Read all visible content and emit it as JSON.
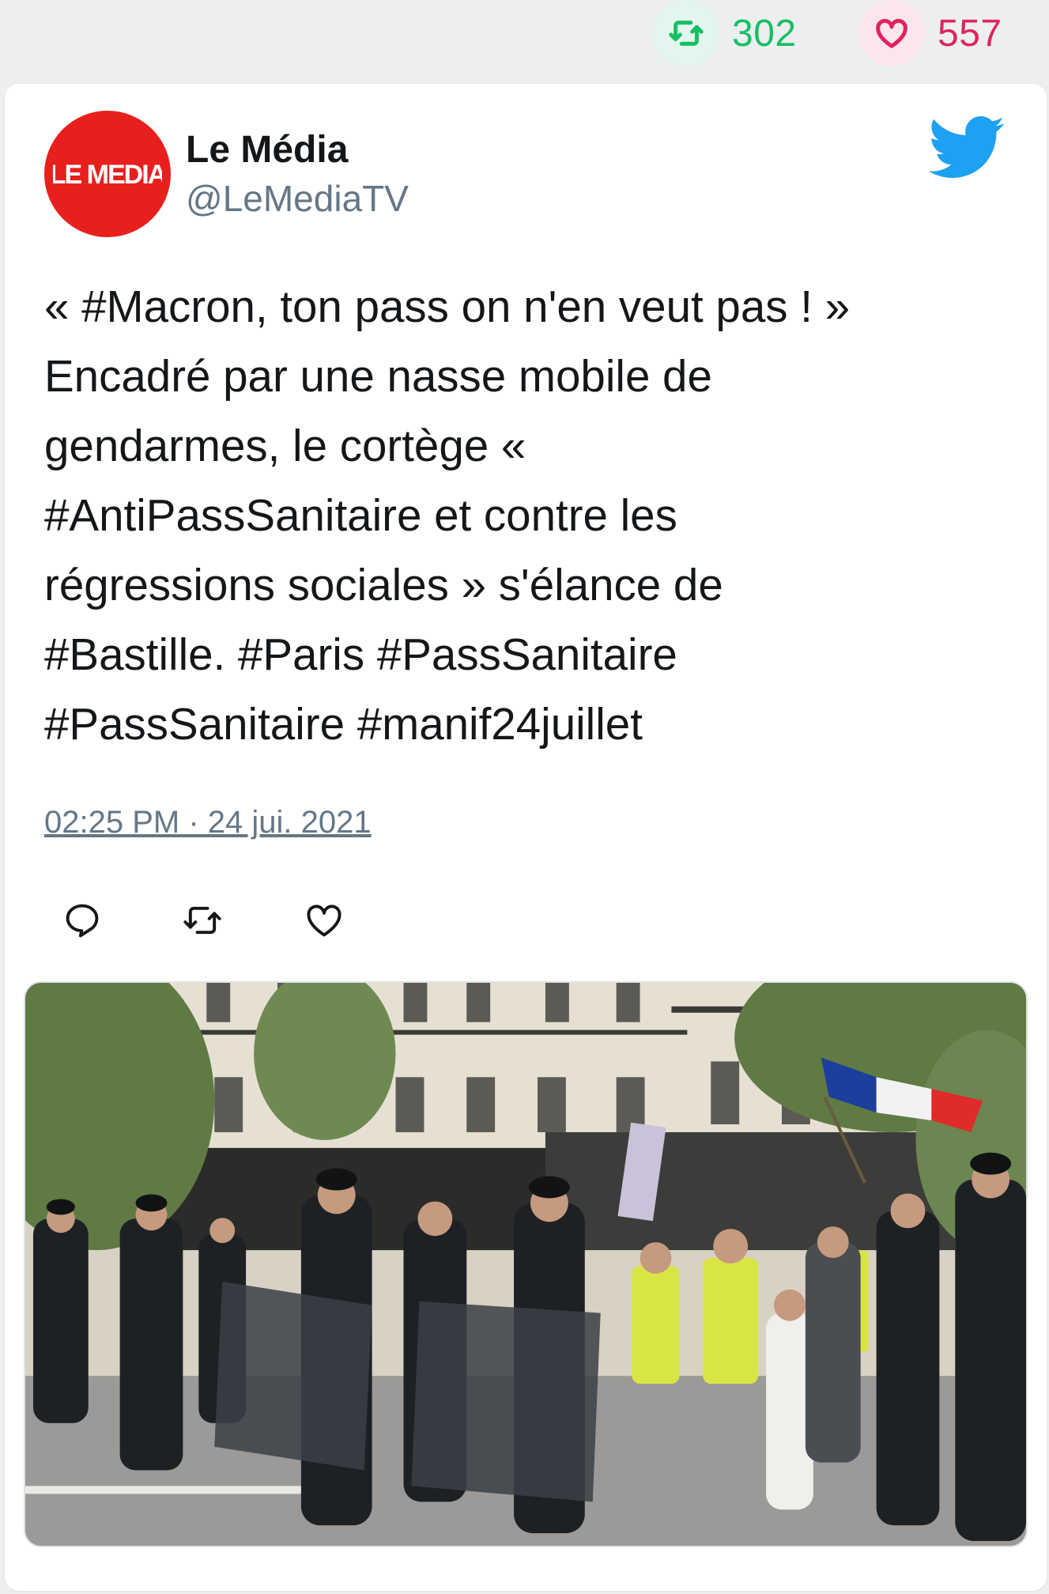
{
  "stats": {
    "retweets": "302",
    "likes": "557",
    "retweet_icon": "retweet-icon",
    "like_icon": "heart-icon"
  },
  "tweet": {
    "author_name": "Le Média",
    "author_handle": "@LeMediaTV",
    "avatar_text": "LE MEDIA",
    "text": "« #Macron, ton pass on n'en veut pas ! »\nEncadré par une nasse mobile de\ngendarmes, le cortège «\n#AntiPassSanitaire et contre les\nrégressions sociales » s'élance de\n#Bastille. #Paris #PassSanitaire\n#PassSanitaire #manif24juillet",
    "timestamp": "02:25 PM · 24 jui. 2021"
  },
  "actions": [
    {
      "icon": "reply-icon"
    },
    {
      "icon": "retweet-icon"
    },
    {
      "icon": "like-icon"
    }
  ],
  "colors": {
    "retweet": "#17bf63",
    "like": "#e0245e",
    "twitter_blue": "#1da1f2",
    "avatar_red": "#e8201d",
    "background": "#eceef0"
  }
}
